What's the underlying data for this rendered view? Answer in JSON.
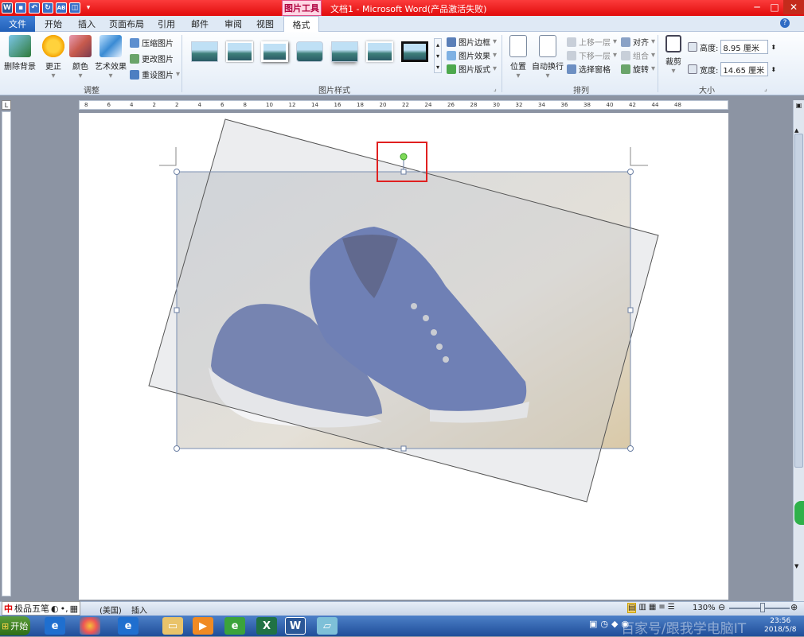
{
  "title_bar": {
    "context_tab": "图片工具",
    "document_title": "文档1 - Microsoft Word(产品激活失败)",
    "minimize": "─",
    "restore": "□",
    "close": "✕"
  },
  "tabs": [
    "文件",
    "开始",
    "插入",
    "页面布局",
    "引用",
    "邮件",
    "审阅",
    "视图",
    "格式"
  ],
  "ribbon": {
    "adjust": {
      "remove_bg": "删除背景",
      "corrections": "更正",
      "color": "颜色",
      "artistic": "艺术效果",
      "compress": "压缩图片",
      "change": "更改图片",
      "reset": "重设图片",
      "label": "调整"
    },
    "styles": {
      "border": "图片边框",
      "effects": "图片效果",
      "layout": "图片版式",
      "label": "图片样式"
    },
    "arrange": {
      "position": "位置",
      "wrap": "自动换行",
      "bring_forward": "上移一层",
      "send_backward": "下移一层",
      "selection_pane": "选择窗格",
      "align": "对齐",
      "group": "组合",
      "rotate": "旋转",
      "label": "排列"
    },
    "size": {
      "crop": "裁剪",
      "height_label": "高度:",
      "height_value": "8.95 厘米",
      "width_label": "宽度:",
      "width_value": "14.65 厘米",
      "label": "大小"
    }
  },
  "status": {
    "ime": "极品五笔",
    "language": "(美国)",
    "mode": "插入",
    "zoom": "130%"
  },
  "taskbar": {
    "start": "开始",
    "clock_time": "23:56",
    "clock_date": "2018/5/8",
    "watermark": "百家号/跟我学电脑IT"
  },
  "ruler_top": [
    "8",
    "6",
    "4",
    "2",
    "2",
    "4",
    "6",
    "8",
    "10",
    "12",
    "14",
    "16",
    "18",
    "20",
    "22",
    "24",
    "26",
    "28",
    "30",
    "32",
    "34",
    "36",
    "38",
    "40",
    "42",
    "44",
    "48"
  ]
}
